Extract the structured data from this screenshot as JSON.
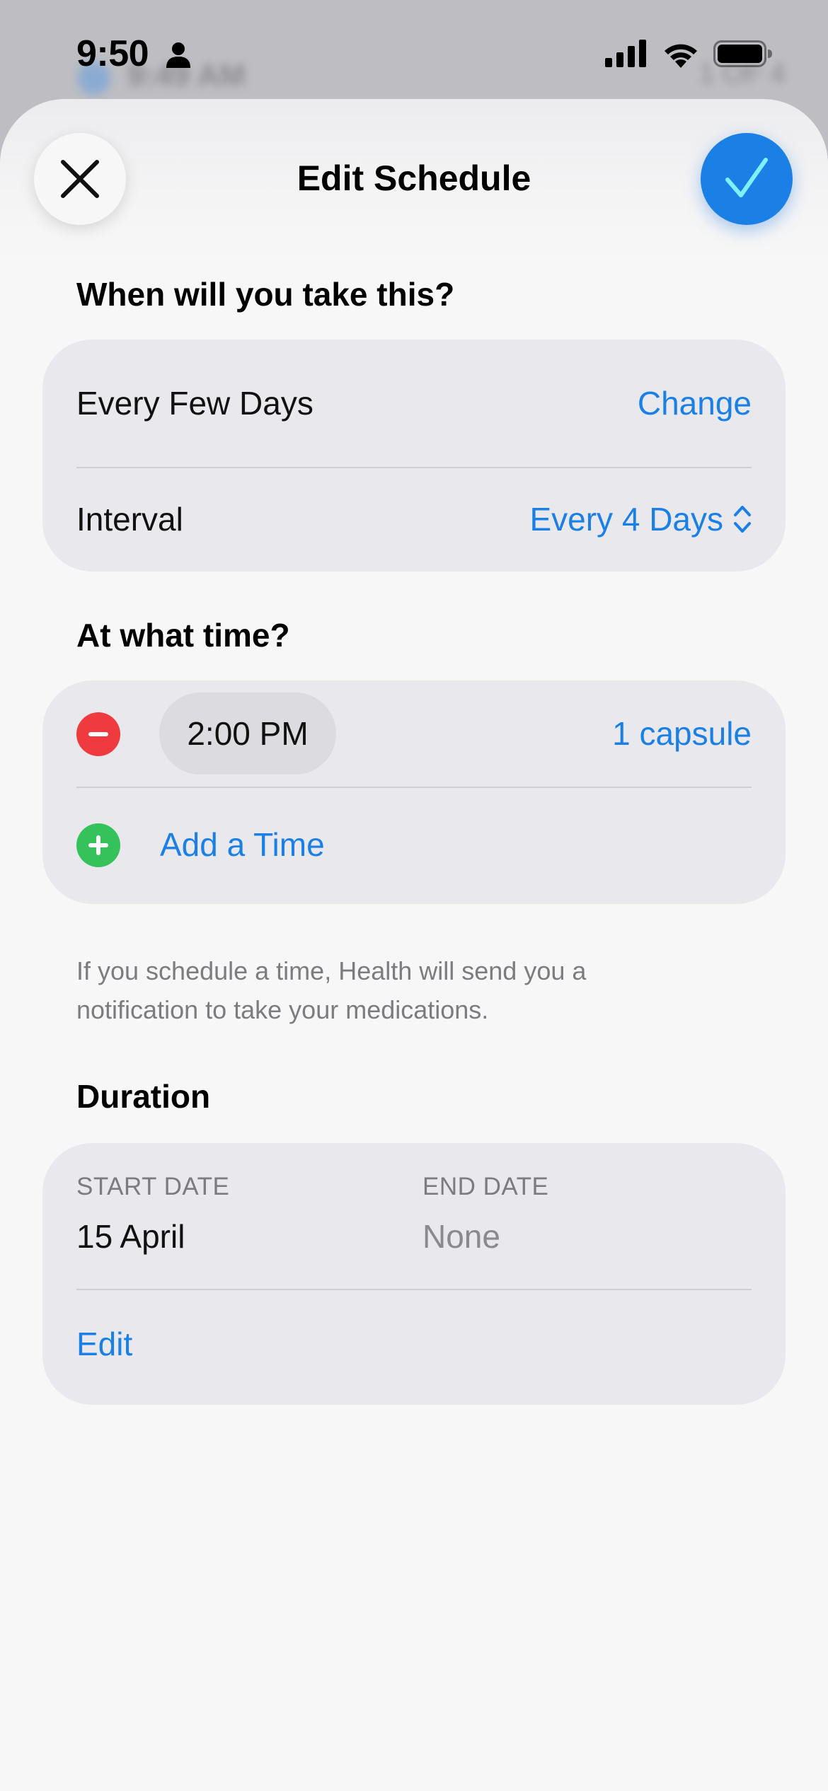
{
  "status_bar": {
    "time": "9:50"
  },
  "background_app": {
    "time_text": "9:49 AM",
    "right_text": "1 OF 4"
  },
  "header": {
    "title": "Edit Schedule"
  },
  "frequency_section": {
    "header": "When will you take this?",
    "frequency_label": "Every Few Days",
    "change_label": "Change",
    "interval_label": "Interval",
    "interval_value": "Every 4 Days"
  },
  "time_section": {
    "header": "At what time?",
    "times": [
      {
        "time": "2:00 PM",
        "dose": "1 capsule"
      }
    ],
    "add_time_label": "Add a Time",
    "footnote": "If you schedule a time, Health will send you a notification to take your medications."
  },
  "duration_section": {
    "header": "Duration",
    "start_caption": "START DATE",
    "start_value": "15 April",
    "end_caption": "END DATE",
    "end_value": "None",
    "edit_label": "Edit"
  },
  "colors": {
    "accent": "#1a80e6",
    "destructive": "#ef3a3f",
    "add": "#35c25b",
    "card_background": "#e9e9ed",
    "sheet_background": "#f7f7f7"
  },
  "icons": {
    "close": "close-icon",
    "confirm": "checkmark-icon",
    "remove_time": "minus-icon",
    "add_time": "plus-icon",
    "interval_picker": "chevron-up-down-icon"
  }
}
